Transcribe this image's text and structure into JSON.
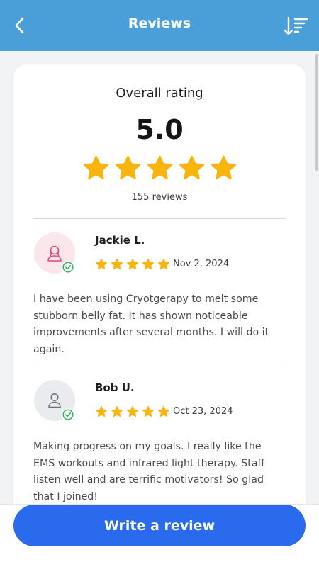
{
  "header": {
    "title": "Reviews",
    "back_icon": "chevron-left-icon",
    "sort_icon": "sort-descending-icon"
  },
  "summary": {
    "heading": "Overall rating",
    "score": "5.0",
    "stars": 5,
    "count_label": "155 reviews"
  },
  "reviews": [
    {
      "name": "Jackie L.",
      "stars": 5,
      "date": "Nov 2, 2024",
      "text": "I have been using Cryotgerapy to melt some stubborn belly fat. It has shown noticeable improvements after several months. I will do it again.",
      "avatar_icon": "female-user-icon",
      "verified_icon": "verified-check-icon"
    },
    {
      "name": "Bob U.",
      "stars": 5,
      "date": "Oct 23, 2024",
      "text": "Making progress on my goals. I really like the EMS workouts and infrared light therapy. Staff listen well and are terrific motivators! So glad that I joined!",
      "avatar_icon": "user-icon",
      "verified_icon": "verified-check-icon"
    }
  ],
  "footer": {
    "write_review_label": "Write a review"
  },
  "colors": {
    "header": "#4a9fd8",
    "star": "#f8b40f",
    "button": "#2a6bee",
    "verified": "#2fb55a",
    "avatar_pink": "#fbe6ec",
    "avatar_gray": "#e9ebee"
  }
}
